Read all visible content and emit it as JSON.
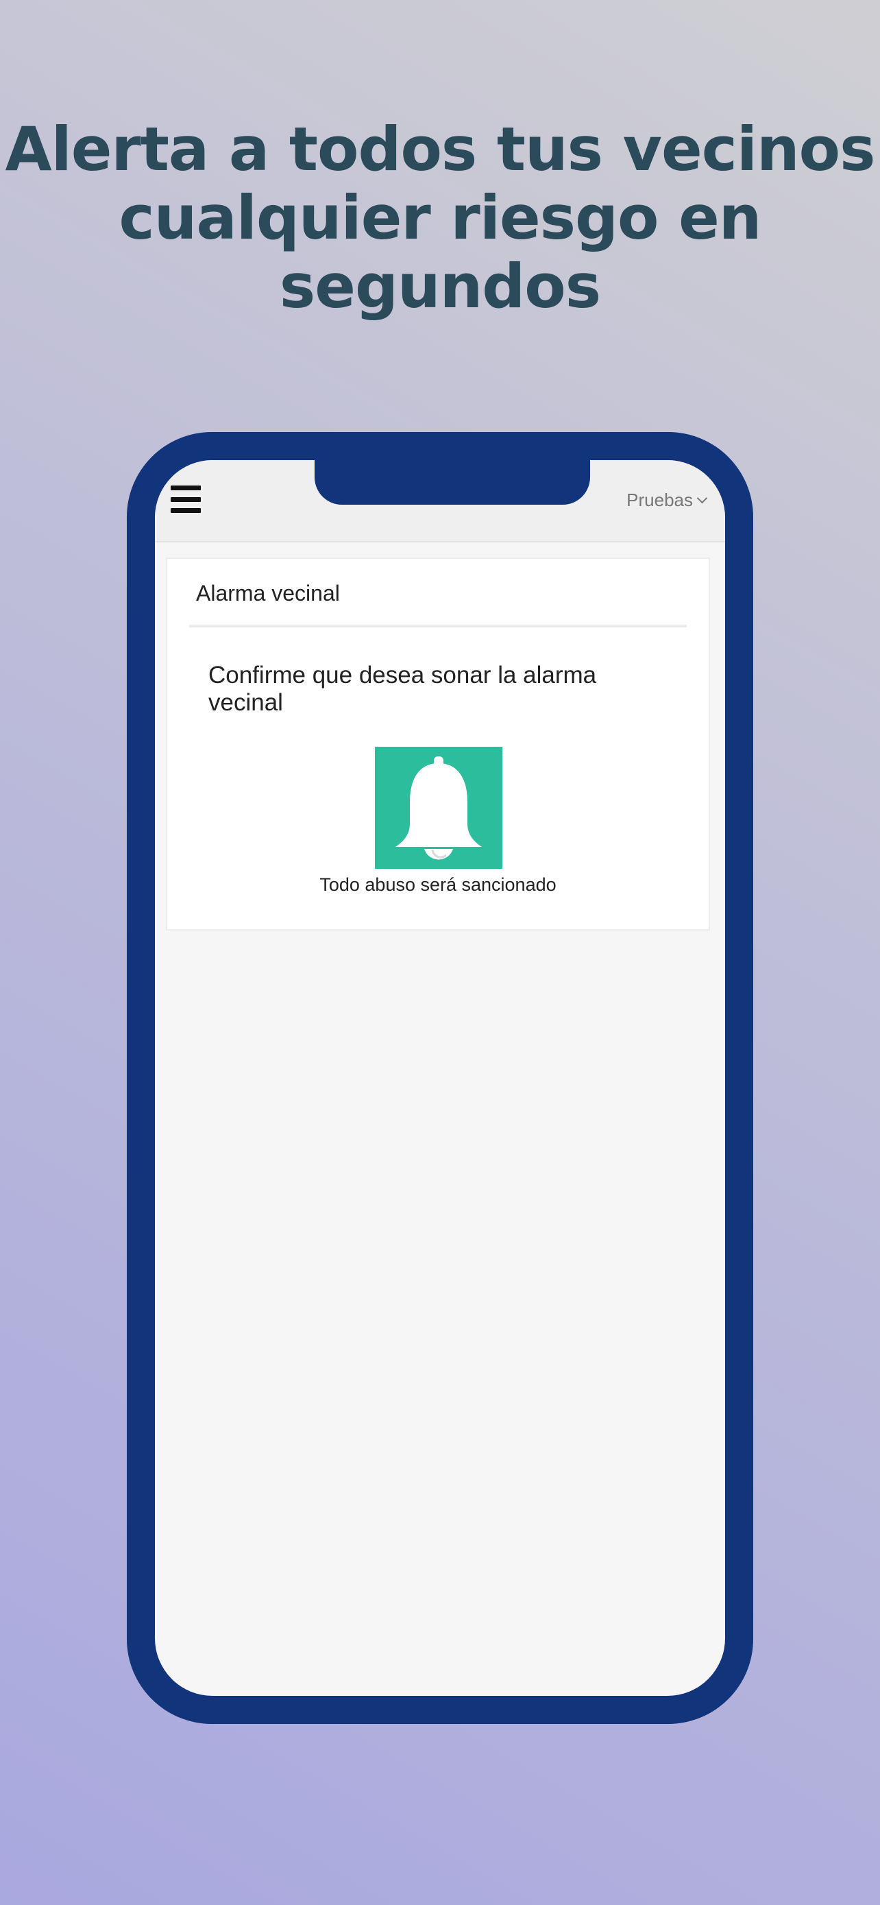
{
  "headline": {
    "line1": "Alerta a todos tus vecinos",
    "line2": "cualquier riesgo en",
    "line3": "segundos"
  },
  "appbar": {
    "menu_icon": "hamburger-menu-icon",
    "account_label": "Pruebas",
    "account_icon": "chevron-down-icon"
  },
  "card": {
    "title": "Alarma vecinal",
    "message": "Confirme que desea sonar la alarma vecinal",
    "alarm_icon": "bell-icon",
    "caption": "Todo abuso será sancionado"
  },
  "colors": {
    "phone_frame": "#12347a",
    "alarm_button": "#2bbd9c",
    "headline_text": "#2b4a5a"
  }
}
